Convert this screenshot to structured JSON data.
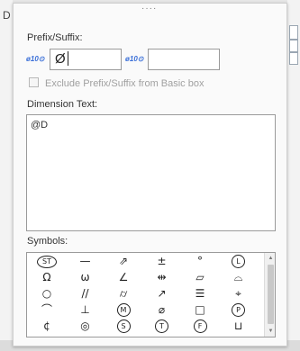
{
  "background": {
    "left_fragment": "D"
  },
  "panel": {
    "grip": "····"
  },
  "prefix_suffix": {
    "label": "Prefix/Suffix:",
    "toggle_label": "ø10⊙",
    "prefix_value": "Ø",
    "suffix_value": "",
    "exclude_label": "Exclude Prefix/Suffix from Basic box",
    "exclude_checked": false,
    "exclude_enabled": false
  },
  "dimension_text": {
    "label": "Dimension Text:",
    "value": "@D"
  },
  "symbols": {
    "label": "Symbols:",
    "rows": [
      [
        "ST",
        "—",
        "⇗",
        "±",
        "°",
        "L"
      ],
      [
        "Ω",
        "ω",
        "∠",
        "⇹",
        "▱",
        "⌓"
      ],
      [
        "○",
        "//",
        "⌭",
        "↗",
        "☰",
        "⌖"
      ],
      [
        "⌒",
        "⊥",
        "M",
        "⌀",
        "□",
        "P"
      ],
      [
        "¢",
        "◎",
        "S",
        "T",
        "F",
        "⊔"
      ]
    ],
    "ringed": [
      "ST",
      "L",
      "M",
      "P",
      "S",
      "T",
      "F"
    ]
  }
}
